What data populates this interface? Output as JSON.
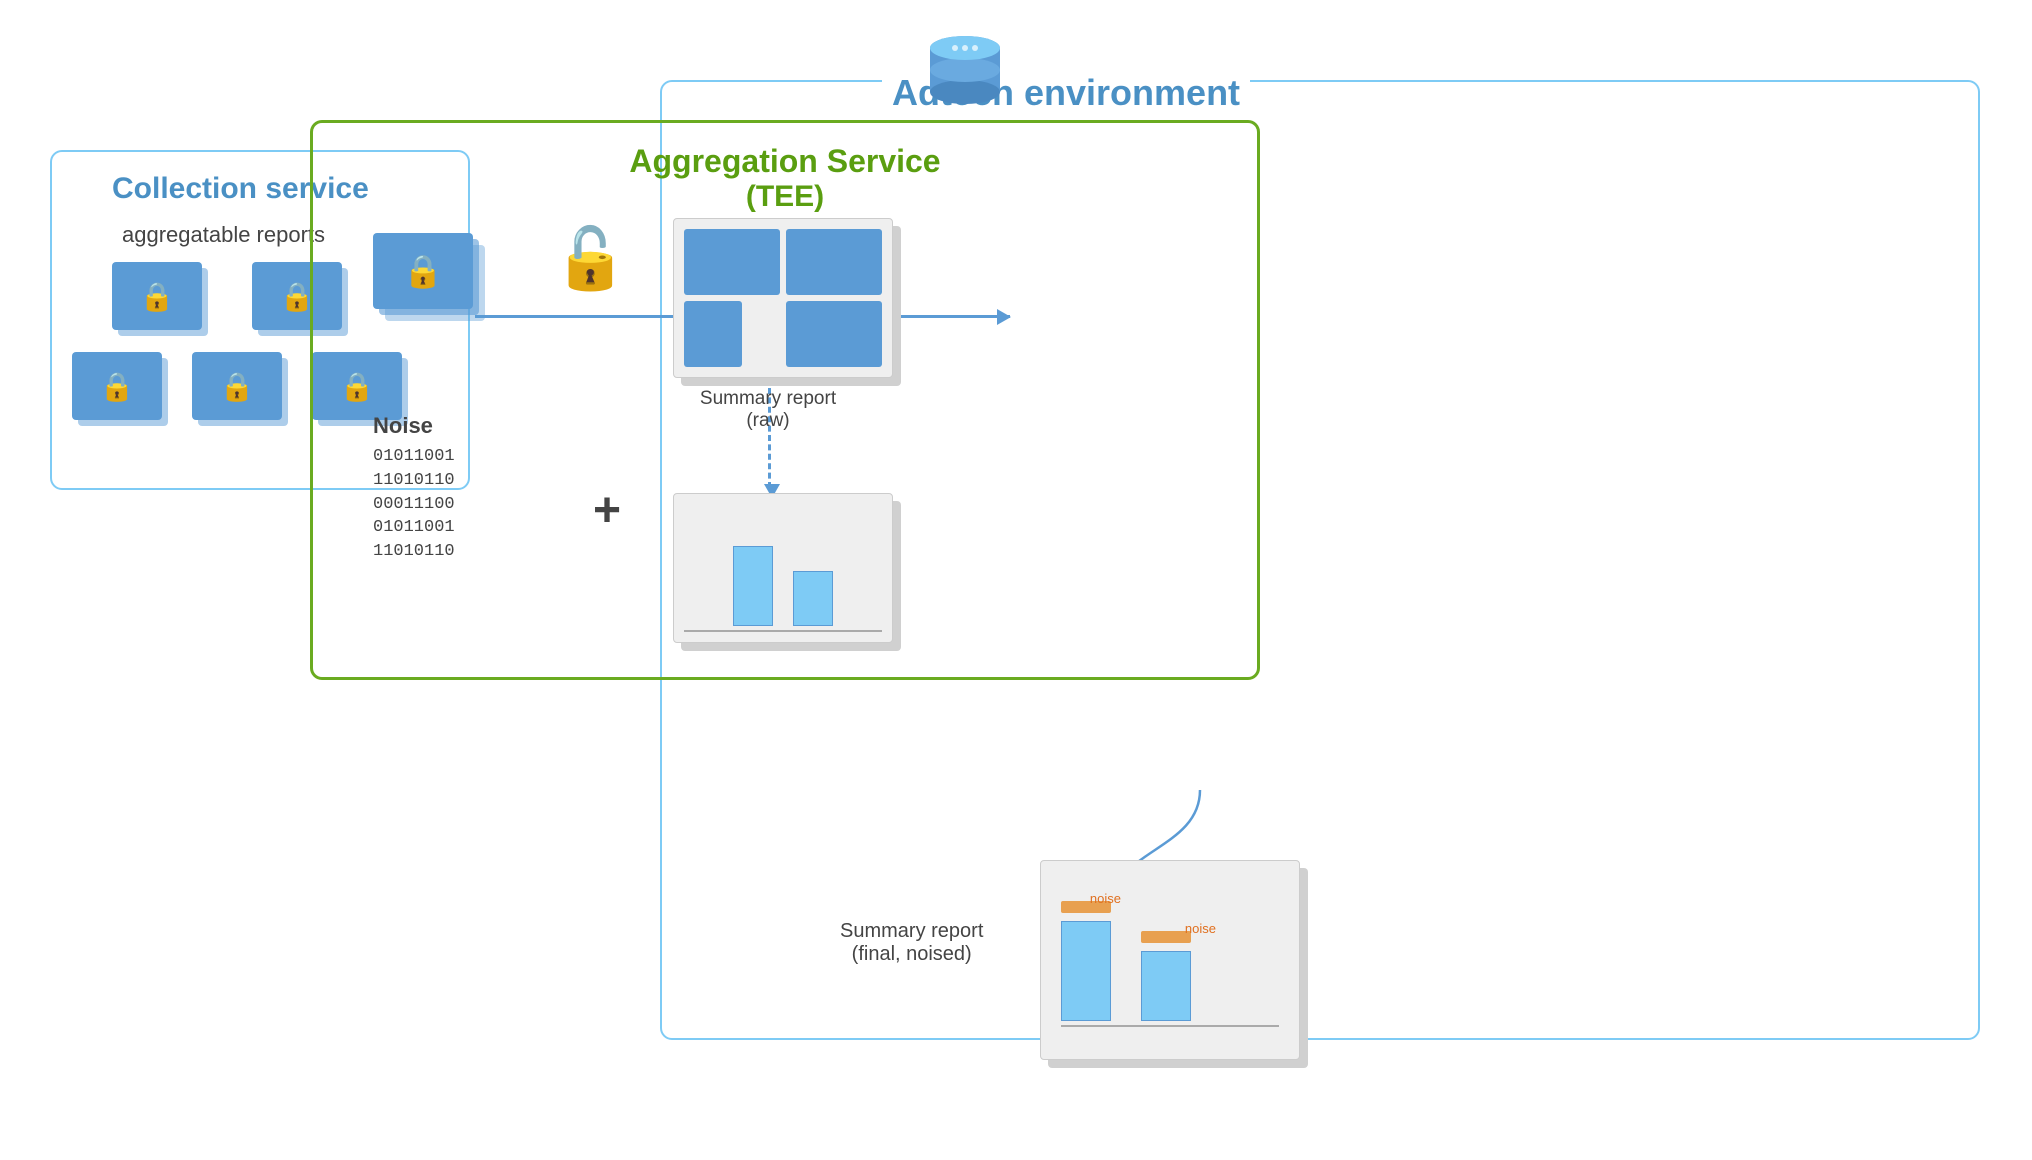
{
  "diagram": {
    "adtech_label": "Adtech environment",
    "collection_label": "Collection service",
    "aggregatable_reports": "aggregatable reports",
    "aggregation_label": "Aggregation Service",
    "aggregation_sublabel": "(TEE)",
    "noise_label": "Noise",
    "noise_code": [
      "01011001",
      "11010110",
      "00011100",
      "01011001",
      "11010110"
    ],
    "summary_report_raw": "Summary report\n(raw)",
    "summary_report_final": "Summary report\n(final, noised)",
    "noise_tag1": "noise",
    "noise_tag2": "noise",
    "plus_symbol": "+"
  }
}
